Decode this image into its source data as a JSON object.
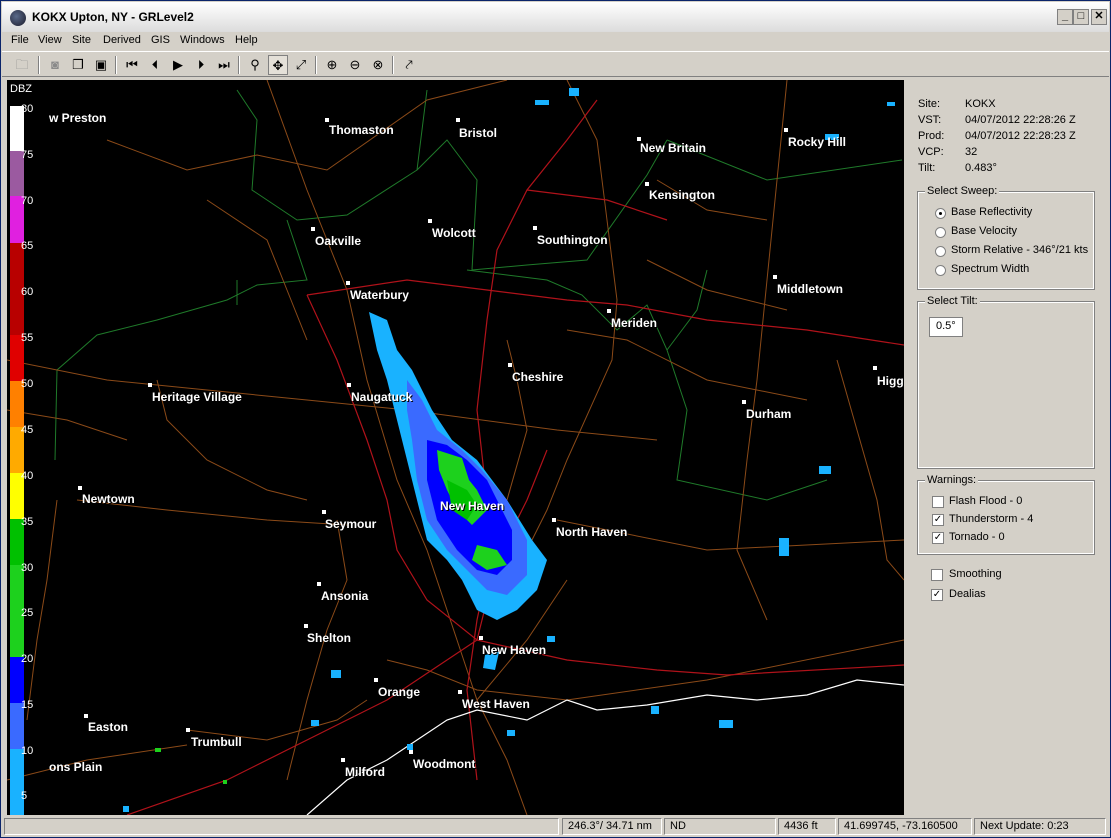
{
  "window": {
    "title": "KOKX Upton, NY - GRLevel2",
    "min": "_",
    "max": "□",
    "close": "✕"
  },
  "menu": [
    "File",
    "View",
    "Site",
    "Derived",
    "GIS",
    "Windows",
    "Help"
  ],
  "colorbar": {
    "unit": "DBZ",
    "ticks": [
      "80",
      "75",
      "70",
      "65",
      "60",
      "55",
      "50",
      "45",
      "40",
      "35",
      "30",
      "25",
      "20",
      "15",
      "10",
      "5"
    ],
    "colors": [
      "#ffffff",
      "#9b5aa0",
      "#e020e0",
      "#b80000",
      "#e00000",
      "#ff8000",
      "#ffaa00",
      "#ffff00",
      "#00c000",
      "#1dd11d",
      "#0000ff",
      "#3a6aff",
      "#19b2ff"
    ]
  },
  "cities": [
    {
      "name": "w Preston"
    },
    {
      "name": "Thomaston"
    },
    {
      "name": "Bristol"
    },
    {
      "name": "New Britain"
    },
    {
      "name": "Rocky Hill"
    },
    {
      "name": "Kensington"
    },
    {
      "name": "Oakville"
    },
    {
      "name": "Wolcott"
    },
    {
      "name": "Southington"
    },
    {
      "name": "Waterbury"
    },
    {
      "name": "Middletown"
    },
    {
      "name": "Meriden"
    },
    {
      "name": "Cheshire"
    },
    {
      "name": "Higg"
    },
    {
      "name": "Heritage Village"
    },
    {
      "name": "Naugatuck"
    },
    {
      "name": "Durham"
    },
    {
      "name": "Newtown"
    },
    {
      "name": "New Haven"
    },
    {
      "name": "Seymour"
    },
    {
      "name": "North Haven"
    },
    {
      "name": "Ansonia"
    },
    {
      "name": "Shelton"
    },
    {
      "name": "New Haven"
    },
    {
      "name": "Orange"
    },
    {
      "name": "West Haven"
    },
    {
      "name": "Easton"
    },
    {
      "name": "Trumbull"
    },
    {
      "name": "Milford"
    },
    {
      "name": "Woodmont"
    },
    {
      "name": "ons Plain"
    }
  ],
  "panel": {
    "site_label": "Site:",
    "site": "KOKX",
    "vst_label": "VST:",
    "vst": "04/07/2012  22:28:26 Z",
    "prod_label": "Prod:",
    "prod": "04/07/2012  22:28:23 Z",
    "vcp_label": "VCP:",
    "vcp": "32",
    "tilt_label": "Tilt:",
    "tilt": "0.483°",
    "sweep_title": "Select Sweep:",
    "sweeps": [
      "Base Reflectivity",
      "Base Velocity",
      "Storm Relative - 346°/21 kts",
      "Spectrum Width"
    ],
    "sweep_selected": "Base Reflectivity",
    "tiltbox_title": "Select Tilt:",
    "tilt_value": "0.5°",
    "warnings_title": "Warnings:",
    "warnings": [
      {
        "label": "Flash Flood - 0",
        "checked": false
      },
      {
        "label": "Thunderstorm - 4",
        "checked": true
      },
      {
        "label": "Tornado - 0",
        "checked": true
      }
    ],
    "smoothing": {
      "label": "Smoothing",
      "checked": false
    },
    "dealias": {
      "label": "Dealias",
      "checked": true
    }
  },
  "status": {
    "blank": "",
    "bearing": "246.3°/ 34.71 nm",
    "value": "ND",
    "blank2": "",
    "height": "4436 ft",
    "coords": "41.699745, -73.160500",
    "update": "Next Update: 0:23"
  }
}
